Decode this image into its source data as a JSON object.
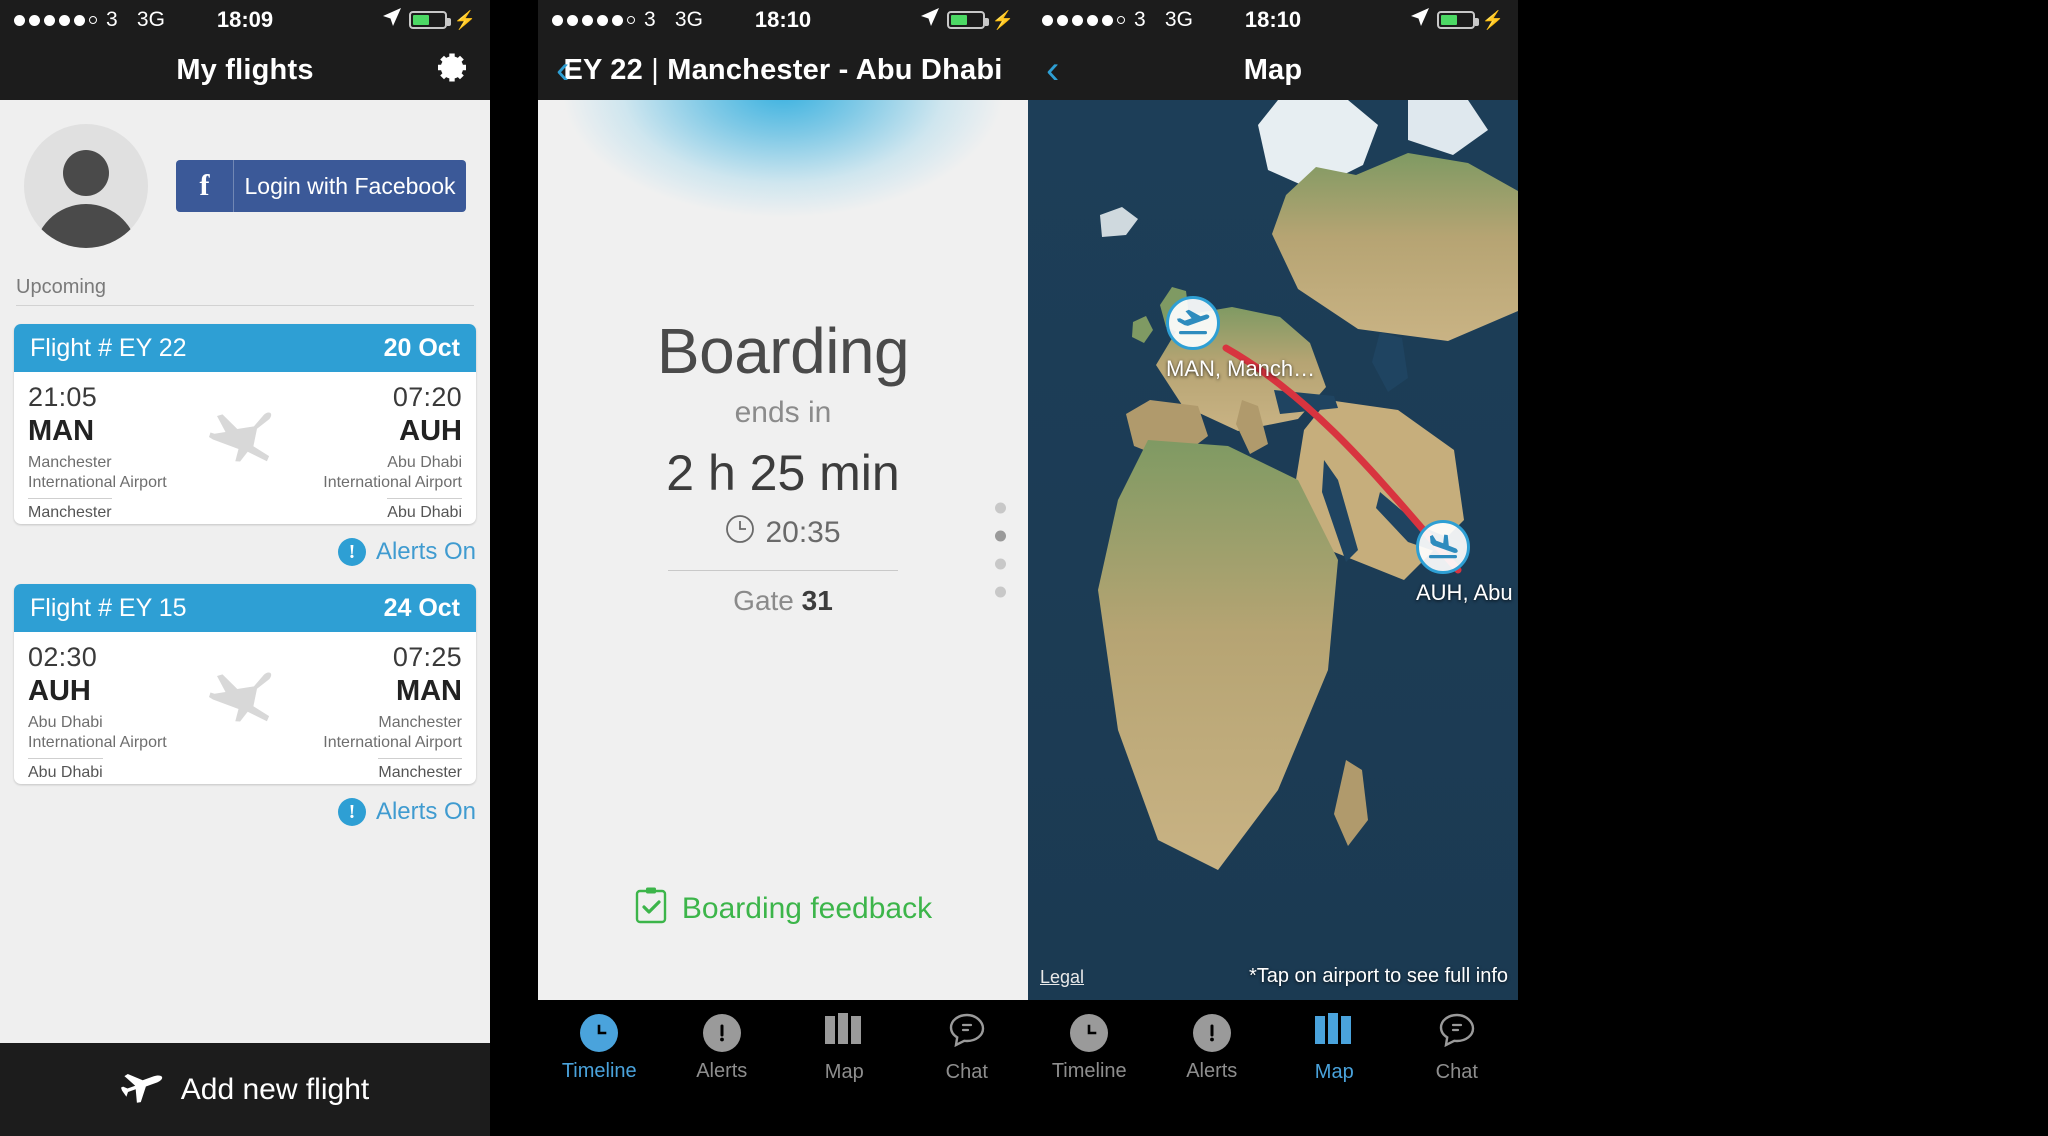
{
  "screen1": {
    "statusbar": {
      "carrier": "3",
      "network": "3G",
      "time": "18:09",
      "signal_dots": 5,
      "signal_total": 6,
      "battery_pct": 55
    },
    "nav": {
      "title": "My flights",
      "settings_icon": "gear-icon"
    },
    "profile": {
      "avatar_icon": "avatar-placeholder-icon",
      "facebook_button": "Login with Facebook",
      "facebook_icon": "facebook-f-icon",
      "facebook_color": "#3b5998"
    },
    "section_label": "Upcoming",
    "flights": [
      {
        "header_label": "Flight # EY 22",
        "date": "20 Oct",
        "depart": {
          "time": "21:05",
          "code": "MAN",
          "airport": "Manchester\nInternational Airport",
          "city": "Manchester"
        },
        "arrive": {
          "time": "07:20",
          "code": "AUH",
          "airport": "Abu Dhabi\nInternational Airport",
          "city": "Abu Dhabi"
        },
        "alerts": "Alerts On"
      },
      {
        "header_label": "Flight # EY 15",
        "date": "24 Oct",
        "depart": {
          "time": "02:30",
          "code": "AUH",
          "airport": "Abu Dhabi\nInternational Airport",
          "city": "Abu Dhabi"
        },
        "arrive": {
          "time": "07:25",
          "code": "MAN",
          "airport": "Manchester\nInternational Airport",
          "city": "Manchester"
        },
        "alerts": "Alerts On"
      }
    ],
    "add_flight": {
      "label": "Add new flight",
      "icon": "airplane-icon"
    },
    "accent_color": "#2e9fd4"
  },
  "screen2": {
    "statusbar": {
      "carrier": "3",
      "network": "3G",
      "time": "18:10",
      "signal_dots": 5,
      "signal_total": 6,
      "battery_pct": 55
    },
    "nav": {
      "back_icon": "chevron-left-icon",
      "flight_no": "EY 22",
      "separator": "|",
      "route": "Manchester - Abu Dhabi"
    },
    "boarding": {
      "title": "Boarding",
      "subtitle": "ends in",
      "countdown": "2 h 25 min",
      "clock_icon": "clock-icon",
      "clock_time": "20:35",
      "gate_label": "Gate",
      "gate_number": "31"
    },
    "pager": {
      "total": 4,
      "active_index": 1
    },
    "feedback": {
      "label": "Boarding feedback",
      "icon": "clipboard-check-icon",
      "color": "#3cb54a"
    },
    "tabs": [
      {
        "label": "Timeline",
        "icon": "clock-icon",
        "active": true
      },
      {
        "label": "Alerts",
        "icon": "exclamation-icon",
        "active": false
      },
      {
        "label": "Map",
        "icon": "map-icon",
        "active": false
      },
      {
        "label": "Chat",
        "icon": "chat-icon",
        "active": false
      }
    ]
  },
  "screen3": {
    "statusbar": {
      "carrier": "3",
      "network": "3G",
      "time": "18:10",
      "signal_dots": 5,
      "signal_total": 6,
      "battery_pct": 55
    },
    "nav": {
      "back_icon": "chevron-left-icon",
      "title": "Map"
    },
    "markers": [
      {
        "code": "MAN",
        "name": "Manch…",
        "icon": "takeoff-icon",
        "label": "MAN, Manch…"
      },
      {
        "code": "AUH",
        "name": "Abu Dh…",
        "icon": "landing-icon",
        "label": "AUH, Abu Dh…"
      }
    ],
    "route_color": "#d8343f",
    "legal": "Legal",
    "hint": "*Tap on airport to see full info",
    "tabs": [
      {
        "label": "Timeline",
        "icon": "clock-icon",
        "active": false
      },
      {
        "label": "Alerts",
        "icon": "exclamation-icon",
        "active": false
      },
      {
        "label": "Map",
        "icon": "map-icon",
        "active": true
      },
      {
        "label": "Chat",
        "icon": "chat-icon",
        "active": false
      }
    ]
  }
}
